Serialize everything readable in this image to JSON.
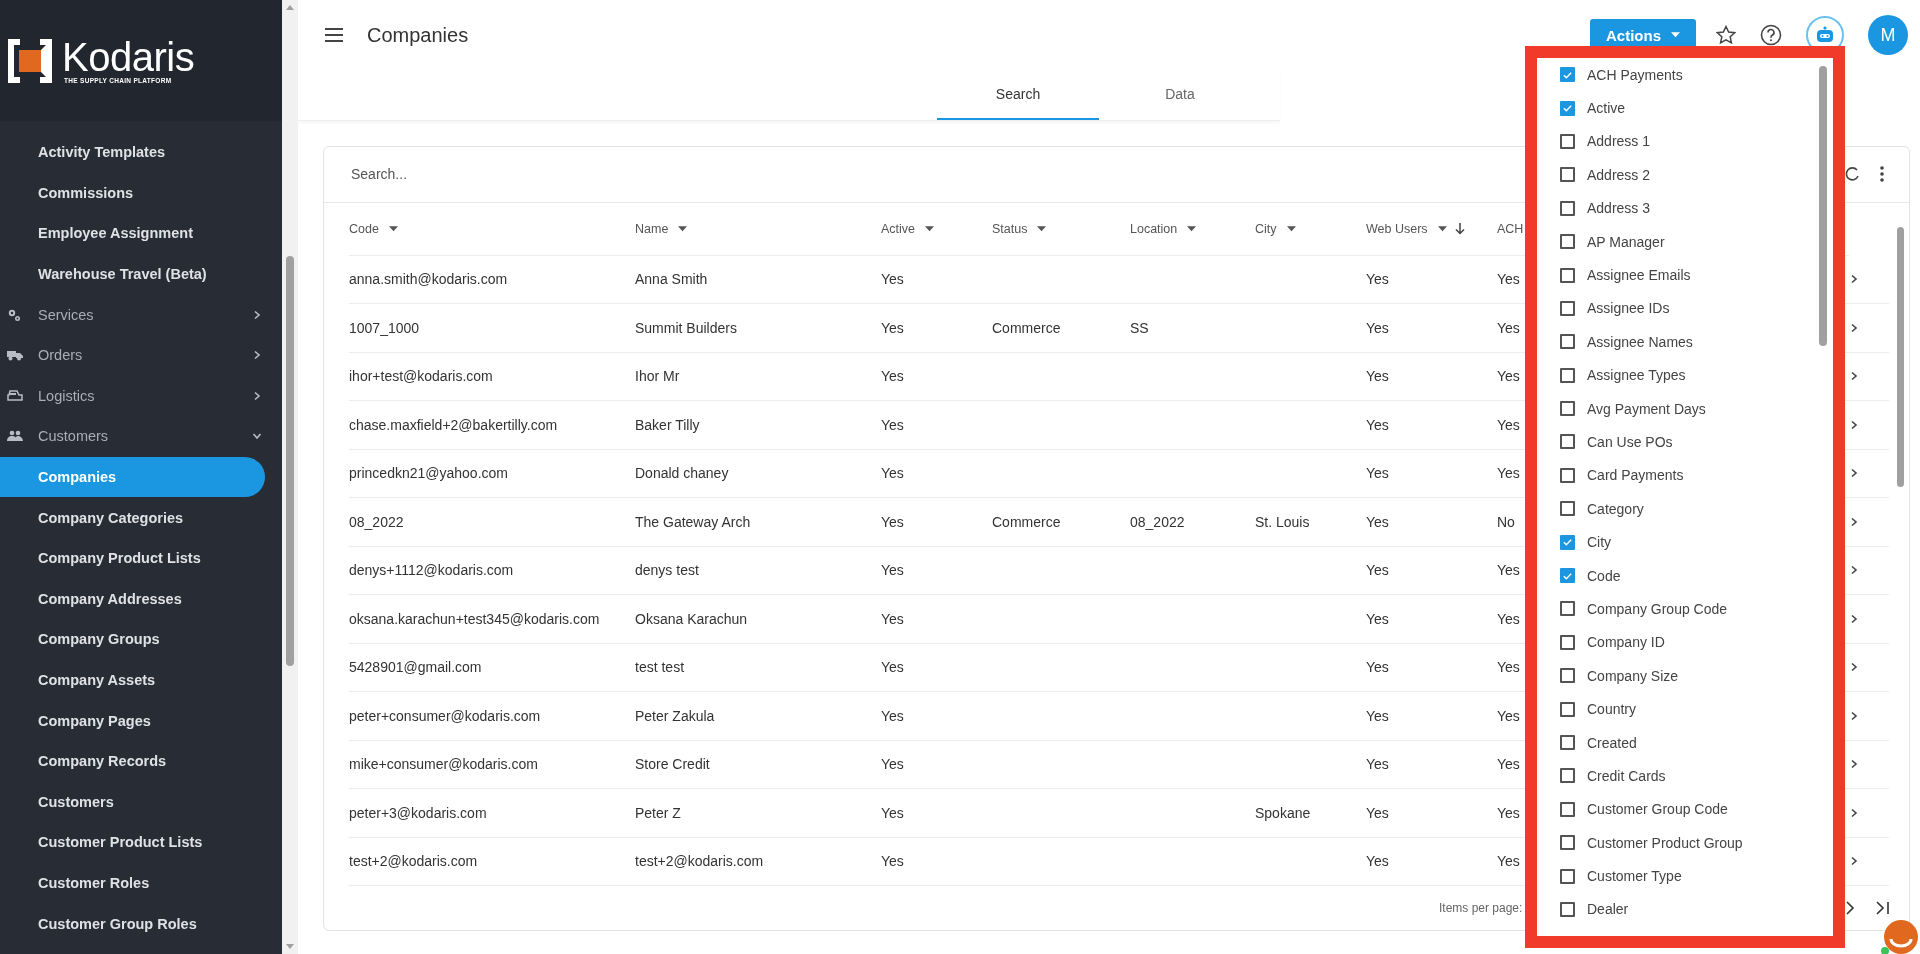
{
  "sidebar": {
    "logo": {
      "name": "Kodaris",
      "tagline": "THE SUPPLY CHAIN PLATFORM"
    },
    "items": [
      {
        "label": "Activity Templates",
        "kind": "link",
        "selected": false
      },
      {
        "label": "Commissions",
        "kind": "link",
        "selected": false
      },
      {
        "label": "Employee Assignment",
        "kind": "link",
        "selected": false
      },
      {
        "label": "Warehouse Travel (Beta)",
        "kind": "link",
        "selected": false
      },
      {
        "label": "Services",
        "kind": "section",
        "expanded": false
      },
      {
        "label": "Orders",
        "kind": "section",
        "expanded": false
      },
      {
        "label": "Logistics",
        "kind": "section",
        "expanded": false
      },
      {
        "label": "Customers",
        "kind": "section",
        "expanded": true
      },
      {
        "label": "Companies",
        "kind": "link",
        "selected": true
      },
      {
        "label": "Company Categories",
        "kind": "link",
        "selected": false
      },
      {
        "label": "Company Product Lists",
        "kind": "link",
        "selected": false
      },
      {
        "label": "Company Addresses",
        "kind": "link",
        "selected": false
      },
      {
        "label": "Company Groups",
        "kind": "link",
        "selected": false
      },
      {
        "label": "Company Assets",
        "kind": "link",
        "selected": false
      },
      {
        "label": "Company Pages",
        "kind": "link",
        "selected": false
      },
      {
        "label": "Company Records",
        "kind": "link",
        "selected": false
      },
      {
        "label": "Customers",
        "kind": "link",
        "selected": false
      },
      {
        "label": "Customer Product Lists",
        "kind": "link",
        "selected": false
      },
      {
        "label": "Customer Roles",
        "kind": "link",
        "selected": false
      },
      {
        "label": "Customer Group Roles",
        "kind": "link",
        "selected": false
      }
    ]
  },
  "header": {
    "title": "Companies",
    "actions": "Actions",
    "avatar": "M"
  },
  "tabs": [
    {
      "label": "Search",
      "selected": true
    },
    {
      "label": "Data",
      "selected": false
    }
  ],
  "table": {
    "search": {
      "placeholder": "Search..."
    },
    "columns": [
      {
        "label": "Code",
        "sorted": false
      },
      {
        "label": "Name",
        "sorted": false
      },
      {
        "label": "Active",
        "sorted": false
      },
      {
        "label": "Status",
        "sorted": false
      },
      {
        "label": "Location",
        "sorted": false
      },
      {
        "label": "City",
        "sorted": false
      },
      {
        "label": "Web Users",
        "sorted": true
      },
      {
        "label": "ACH"
      }
    ],
    "rows": [
      {
        "code": "anna.smith@kodaris.com",
        "name": "Anna Smith",
        "active": "Yes",
        "web_users": "Yes",
        "ach": "Yes"
      },
      {
        "code": "1007_1000",
        "name": "Summit Builders",
        "active": "Yes",
        "status": "Commerce",
        "location": "SS",
        "web_users": "Yes",
        "ach": "Yes"
      },
      {
        "code": "ihor+test@kodaris.com",
        "name": "Ihor Mr",
        "active": "Yes",
        "web_users": "Yes",
        "ach": "Yes"
      },
      {
        "code": "chase.maxfield+2@bakertilly.com",
        "name": "Baker Tilly",
        "active": "Yes",
        "web_users": "Yes",
        "ach": "Yes"
      },
      {
        "code": "princedkn21@yahoo.com",
        "name": "Donald chaney",
        "active": "Yes",
        "web_users": "Yes",
        "ach": "Yes"
      },
      {
        "code": "08_2022",
        "name": "The Gateway Arch",
        "active": "Yes",
        "status": "Commerce",
        "location": "08_2022",
        "city": "St. Louis",
        "web_users": "Yes",
        "ach": "No"
      },
      {
        "code": "denys+1112@kodaris.com",
        "name": "denys test",
        "active": "Yes",
        "web_users": "Yes",
        "ach": "Yes"
      },
      {
        "code": "oksana.karachun+test345@kodaris.com",
        "name": "Oksana Karachun",
        "active": "Yes",
        "web_users": "Yes",
        "ach": "Yes"
      },
      {
        "code": "5428901@gmail.com",
        "name": "test test",
        "active": "Yes",
        "web_users": "Yes",
        "ach": "Yes"
      },
      {
        "code": "peter+consumer@kodaris.com",
        "name": "Peter Zakula",
        "active": "Yes",
        "web_users": "Yes",
        "ach": "Yes"
      },
      {
        "code": "mike+consumer@kodaris.com",
        "name": "Store Credit",
        "active": "Yes",
        "web_users": "Yes",
        "ach": "Yes"
      },
      {
        "code": "peter+3@kodaris.com",
        "name": "Peter Z",
        "active": "Yes",
        "city": "Spokane",
        "web_users": "Yes",
        "ach": "Yes"
      },
      {
        "code": "test+2@kodaris.com",
        "name": "test+2@kodaris.com",
        "active": "Yes",
        "web_users": "Yes",
        "ach": "Yes"
      }
    ],
    "footer": {
      "items_per_page": "Items per page:"
    }
  },
  "column_menu": {
    "highlighted": true,
    "items": [
      {
        "label": "ACH Payments",
        "checked": true
      },
      {
        "label": "Active",
        "checked": true
      },
      {
        "label": "Address 1",
        "checked": false
      },
      {
        "label": "Address 2",
        "checked": false
      },
      {
        "label": "Address 3",
        "checked": false
      },
      {
        "label": "AP Manager",
        "checked": false
      },
      {
        "label": "Assignee Emails",
        "checked": false
      },
      {
        "label": "Assignee IDs",
        "checked": false
      },
      {
        "label": "Assignee Names",
        "checked": false
      },
      {
        "label": "Assignee Types",
        "checked": false
      },
      {
        "label": "Avg Payment Days",
        "checked": false
      },
      {
        "label": "Can Use POs",
        "checked": false
      },
      {
        "label": "Card Payments",
        "checked": false
      },
      {
        "label": "Category",
        "checked": false
      },
      {
        "label": "City",
        "checked": true
      },
      {
        "label": "Code",
        "checked": true
      },
      {
        "label": "Company Group Code",
        "checked": false
      },
      {
        "label": "Company ID",
        "checked": false
      },
      {
        "label": "Company Size",
        "checked": false
      },
      {
        "label": "Country",
        "checked": false
      },
      {
        "label": "Created",
        "checked": false
      },
      {
        "label": "Credit Cards",
        "checked": false
      },
      {
        "label": "Customer Group Code",
        "checked": false
      },
      {
        "label": "Customer Product Group",
        "checked": false
      },
      {
        "label": "Customer Type",
        "checked": false
      },
      {
        "label": "Dealer",
        "checked": false
      }
    ]
  }
}
